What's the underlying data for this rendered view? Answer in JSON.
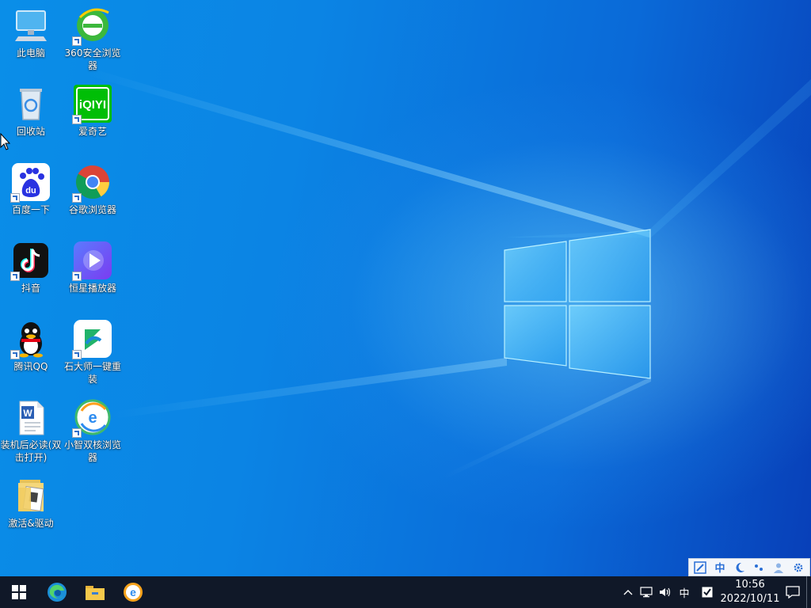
{
  "desktop": {
    "icons": [
      {
        "label": "此电脑",
        "icon": "computer-icon"
      },
      {
        "label": "360安全浏览器",
        "icon": "360-browser-icon"
      },
      {
        "label": "回收站",
        "icon": "recycle-bin-icon"
      },
      {
        "label": "爱奇艺",
        "icon": "iqiyi-icon"
      },
      {
        "label": "百度一下",
        "icon": "baidu-icon"
      },
      {
        "label": "谷歌浏览器",
        "icon": "chrome-icon"
      },
      {
        "label": "抖音",
        "icon": "douyin-icon"
      },
      {
        "label": "恒星播放器",
        "icon": "video-player-icon"
      },
      {
        "label": "腾讯QQ",
        "icon": "qq-icon"
      },
      {
        "label": "石大师一键重装",
        "icon": "reinstall-tool-icon"
      },
      {
        "label": "装机后必读(双击打开)",
        "icon": "word-document-icon"
      },
      {
        "label": "小智双核浏览器",
        "icon": "xiaozhi-browser-icon"
      },
      {
        "label": "激活&驱动",
        "icon": "folder-icon"
      }
    ],
    "iqiyi_logo_text": "iQIYI",
    "baidu_logo_text": "du"
  },
  "ime_toolbar": {
    "mode_label": "中",
    "items": [
      "ime-logo-icon",
      "chinese-mode-icon",
      "half-width-icon",
      "punctuation-icon",
      "user-icon",
      "settings-icon"
    ]
  },
  "taskbar": {
    "pinned": [
      "start-icon",
      "edge-icon",
      "file-explorer-icon",
      "browser-icon"
    ],
    "tray": {
      "input_indicator": "中",
      "time": "10:56",
      "date": "2022/10/11"
    }
  },
  "colors": {
    "taskbar": "#101828",
    "accent": "#0a78e0"
  }
}
